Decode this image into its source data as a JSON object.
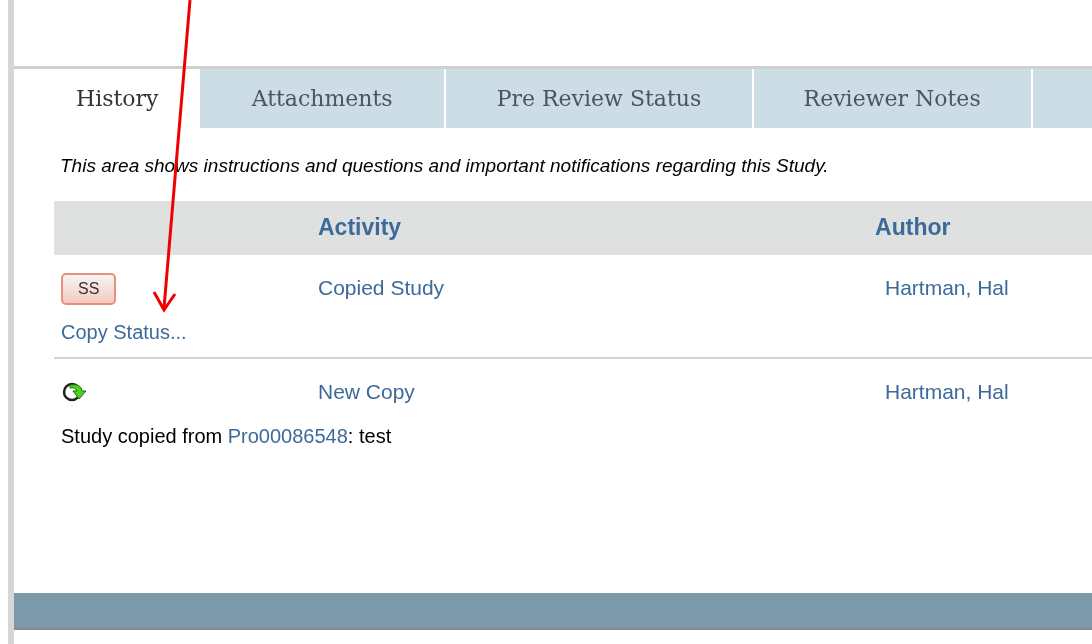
{
  "tabs": [
    {
      "label": "History",
      "selected": true
    },
    {
      "label": "Attachments",
      "selected": false
    },
    {
      "label": "Pre Review Status",
      "selected": false
    },
    {
      "label": "Reviewer Notes",
      "selected": false
    }
  ],
  "instructions": "This area shows instructions and questions and important notifications regarding this Study.",
  "table": {
    "columns": [
      "Activity",
      "Author"
    ],
    "rows": [
      {
        "kind": "badge",
        "badge": "SS",
        "activity": "Copied Study",
        "author": "Hartman, Hal",
        "details": [
          {
            "kind": "link",
            "text": "Copy Status..."
          }
        ]
      },
      {
        "kind": "icon",
        "activity": "New Copy",
        "author": "Hartman, Hal",
        "details": [
          {
            "kind": "text",
            "text": "Study copied from "
          },
          {
            "kind": "link",
            "text": "Pro00086548"
          },
          {
            "kind": "text",
            "text": ": test"
          }
        ]
      }
    ]
  }
}
